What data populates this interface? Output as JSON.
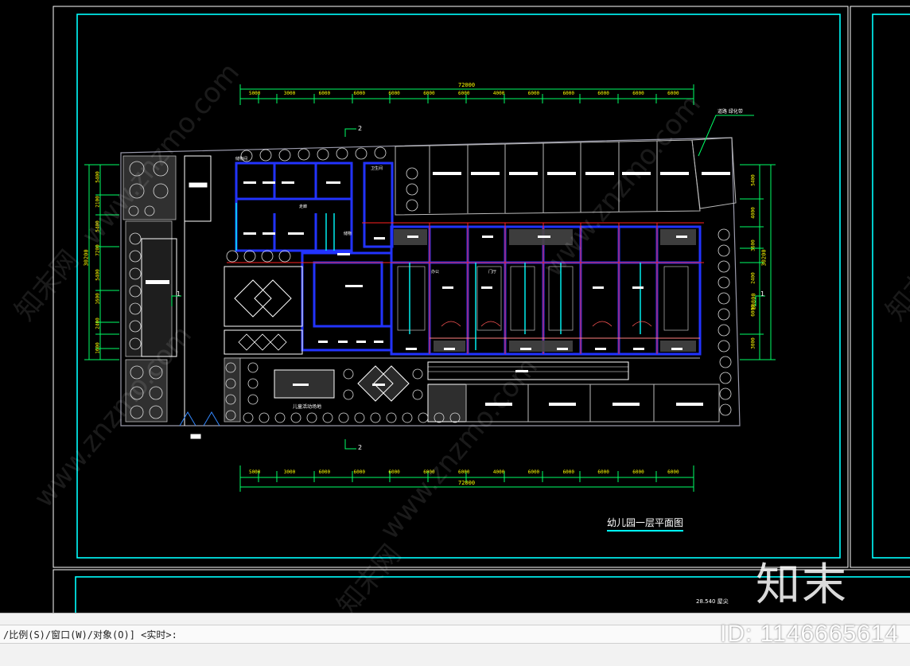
{
  "drawing": {
    "title": "幼儿园一层平面图",
    "top_dimension_total": "72000",
    "bottom_dimension_total": "72000",
    "dimension_segments": [
      "5000",
      "3000",
      "6000",
      "6000",
      "6000",
      "6000",
      "6000",
      "4000",
      "6000",
      "6000",
      "6000",
      "6000",
      "6000"
    ],
    "left_dimensions": [
      "5400",
      "2100",
      "5400",
      "7200",
      "5400",
      "1600",
      "2400",
      "1600"
    ],
    "left_total": "30200",
    "right_dimensions": [
      "5400",
      "4000",
      "3600",
      "2400",
      "6000",
      "3000"
    ],
    "right_total": "30200",
    "right_mid": "10800",
    "section_marks": [
      "2",
      "2",
      "1",
      "1"
    ],
    "leader_label": "道路 绿化带",
    "room_labels": [
      "卫生间",
      "储物间",
      "走廊",
      "储物",
      "办公",
      "门厅"
    ],
    "garden_label": "儿童活动场地",
    "next_sheet_label": "28.540 屋尖"
  },
  "colors": {
    "background": "#000000",
    "frame": "#00ffff",
    "wall": "#1a1aff",
    "axis": "#ff2020",
    "dimension": "#ffff00",
    "line": "#ffffff",
    "command_bg": "#f2f2f2"
  },
  "command_line": {
    "prompt": "/比例(S)/窗口(W)/对象(O)] <实时>:"
  },
  "watermark": {
    "site": "www.znzmo.com",
    "brand": "知末网",
    "logo_text": "知末",
    "id_text": "ID: 1146665614"
  }
}
